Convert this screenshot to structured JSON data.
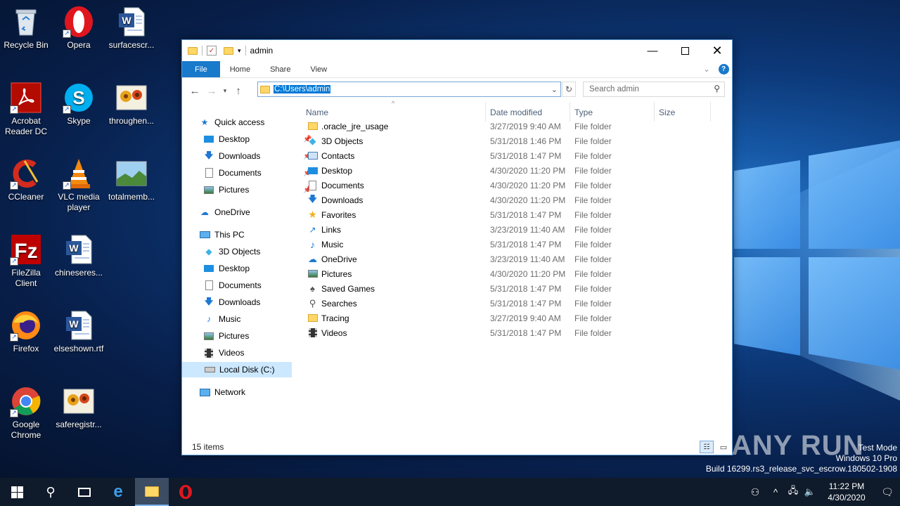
{
  "desktop": {
    "icons": [
      {
        "label": "Recycle Bin",
        "icon": "recycle-bin-icon"
      },
      {
        "label": "Opera",
        "icon": "opera-icon"
      },
      {
        "label": "surfacescr...",
        "icon": "word-doc-icon"
      },
      {
        "label": "Acrobat Reader DC",
        "icon": "acrobat-icon"
      },
      {
        "label": "Skype",
        "icon": "skype-icon"
      },
      {
        "label": "throughen...",
        "icon": "image-file-icon"
      },
      {
        "label": "CCleaner",
        "icon": "ccleaner-icon"
      },
      {
        "label": "VLC media player",
        "icon": "vlc-icon"
      },
      {
        "label": "totalmemb...",
        "icon": "image-file-icon"
      },
      {
        "label": "FileZilla Client",
        "icon": "filezilla-icon"
      },
      {
        "label": "chineseres...",
        "icon": "word-doc-icon"
      },
      {
        "label": "Firefox",
        "icon": "firefox-icon"
      },
      {
        "label": "elseshown.rtf",
        "icon": "word-doc-icon"
      },
      {
        "label": "Google Chrome",
        "icon": "chrome-icon"
      },
      {
        "label": "saferegistr...",
        "icon": "image-file-icon"
      }
    ]
  },
  "window": {
    "title": "admin",
    "ribbon_tabs": [
      "File",
      "Home",
      "Share",
      "View"
    ],
    "address": "C:\\Users\\admin",
    "search_placeholder": "Search admin",
    "nav": {
      "quick_access": "Quick access",
      "quick_items": [
        "Desktop",
        "Downloads",
        "Documents",
        "Pictures"
      ],
      "onedrive": "OneDrive",
      "this_pc": "This PC",
      "pc_items": [
        "3D Objects",
        "Desktop",
        "Documents",
        "Downloads",
        "Music",
        "Pictures",
        "Videos",
        "Local Disk (C:)"
      ],
      "network": "Network"
    },
    "columns": {
      "name": "Name",
      "date": "Date modified",
      "type": "Type",
      "size": "Size"
    },
    "files": [
      {
        "name": ".oracle_jre_usage",
        "date": "3/27/2019 9:40 AM",
        "type": "File folder",
        "icon": "folder-icon"
      },
      {
        "name": "3D Objects",
        "date": "5/31/2018 1:46 PM",
        "type": "File folder",
        "icon": "3d-objects-icon"
      },
      {
        "name": "Contacts",
        "date": "5/31/2018 1:47 PM",
        "type": "File folder",
        "icon": "contacts-icon"
      },
      {
        "name": "Desktop",
        "date": "4/30/2020 11:20 PM",
        "type": "File folder",
        "icon": "desktop-folder-icon"
      },
      {
        "name": "Documents",
        "date": "4/30/2020 11:20 PM",
        "type": "File folder",
        "icon": "documents-icon"
      },
      {
        "name": "Downloads",
        "date": "4/30/2020 11:20 PM",
        "type": "File folder",
        "icon": "downloads-icon"
      },
      {
        "name": "Favorites",
        "date": "5/31/2018 1:47 PM",
        "type": "File folder",
        "icon": "favorites-star-icon"
      },
      {
        "name": "Links",
        "date": "3/23/2019 11:40 AM",
        "type": "File folder",
        "icon": "links-icon"
      },
      {
        "name": "Music",
        "date": "5/31/2018 1:47 PM",
        "type": "File folder",
        "icon": "music-icon"
      },
      {
        "name": "OneDrive",
        "date": "3/23/2019 11:40 AM",
        "type": "File folder",
        "icon": "onedrive-icon"
      },
      {
        "name": "Pictures",
        "date": "4/30/2020 11:20 PM",
        "type": "File folder",
        "icon": "pictures-icon"
      },
      {
        "name": "Saved Games",
        "date": "5/31/2018 1:47 PM",
        "type": "File folder",
        "icon": "saved-games-icon"
      },
      {
        "name": "Searches",
        "date": "5/31/2018 1:47 PM",
        "type": "File folder",
        "icon": "searches-icon"
      },
      {
        "name": "Tracing",
        "date": "3/27/2019 9:40 AM",
        "type": "File folder",
        "icon": "folder-icon"
      },
      {
        "name": "Videos",
        "date": "5/31/2018 1:47 PM",
        "type": "File folder",
        "icon": "videos-icon"
      }
    ],
    "status": "15 items"
  },
  "taskbar": {
    "time": "11:22 PM",
    "date": "4/30/2020"
  },
  "watermark": {
    "line1": "Test Mode",
    "line2": "Windows 10 Pro",
    "line3": "Build 16299.rs3_release_svc_escrow.180502-1908",
    "brand": "ANY RUN"
  }
}
